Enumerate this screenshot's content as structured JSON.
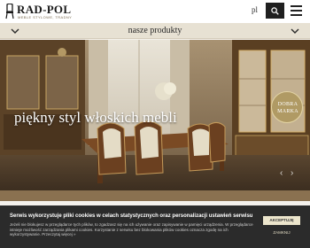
{
  "header": {
    "logo_text": "RAD-POL",
    "logo_tagline": "MEBLE STYLOWE, TRADNY",
    "lang": "pl"
  },
  "nav": {
    "category_label": "nasze produkty"
  },
  "hero": {
    "title": "piękny styl włoskich mebli",
    "badge_line1": "DOBRA",
    "badge_line2": "MARKA"
  },
  "cookie": {
    "title": "Serwis wykorzystuje pliki cookies w celach statystycznych oraz personalizacji ustawień serwisu",
    "text": "Jeżeli nie blokujesz w przeglądarce tych plików, to zgadzasz się na ich używanie oraz zapisywanie w pamięci urządzenia. W przeglądarce istnieje możliwość zarządzania plikami cookies. Korzystanie z serwisu bez blokowania plików cookies oznacza zgodę na ich wykorzystywanie. Przeczytaj więcej »",
    "accept_label": "AKCEPTUJĘ",
    "reject_label": "ZAMKNIJ"
  },
  "colors": {
    "header_bg": "#ffffff",
    "catbar_bg": "#e7e1d3",
    "cookie_bg": "#2b2b2b",
    "accept_bg": "#ece5cc",
    "badge_bg": "#b09a64"
  },
  "icons": {
    "logo": "chair-logo-icon",
    "search": "search-icon",
    "menu": "hamburger-menu-icon",
    "category_left": "chevron-down-icon",
    "category_right": "chevron-down-icon"
  }
}
